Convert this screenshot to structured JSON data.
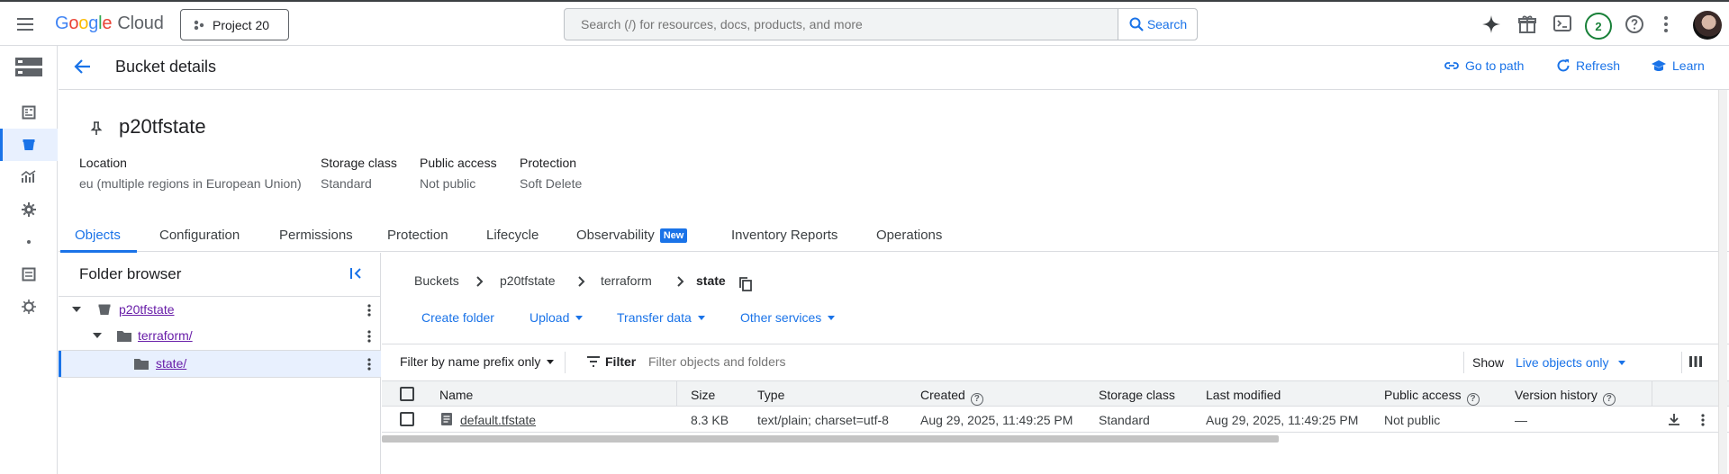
{
  "topbar": {
    "logo_letters": [
      "G",
      "o",
      "o",
      "g",
      "l",
      "e"
    ],
    "logo_suffix": "Cloud",
    "project": "Project 20",
    "search_placeholder": "Search (/) for resources, docs, products, and more",
    "search_button": "Search",
    "notification_count": "2"
  },
  "header": {
    "title": "Bucket details",
    "go_to_path": "Go to path",
    "refresh": "Refresh",
    "learn": "Learn"
  },
  "bucket": {
    "name": "p20tfstate",
    "meta": [
      {
        "label": "Location",
        "value": "eu (multiple regions in European Union)"
      },
      {
        "label": "Storage class",
        "value": "Standard"
      },
      {
        "label": "Public access",
        "value": "Not public"
      },
      {
        "label": "Protection",
        "value": "Soft Delete"
      }
    ]
  },
  "tabs": [
    {
      "label": "Objects",
      "active": true
    },
    {
      "label": "Configuration"
    },
    {
      "label": "Permissions"
    },
    {
      "label": "Protection"
    },
    {
      "label": "Lifecycle"
    },
    {
      "label": "Observability",
      "badge": "New"
    },
    {
      "label": "Inventory Reports"
    },
    {
      "label": "Operations"
    }
  ],
  "folder_browser": {
    "title": "Folder browser",
    "items": [
      {
        "label": "p20tfstate"
      },
      {
        "label": "terraform/"
      },
      {
        "label": "state/"
      }
    ]
  },
  "breadcrumb": [
    "Buckets",
    "p20tfstate",
    "terraform",
    "state"
  ],
  "actions": {
    "create_folder": "Create folder",
    "upload": "Upload",
    "transfer": "Transfer data",
    "other": "Other services"
  },
  "filter": {
    "mode": "Filter by name prefix only",
    "label": "Filter",
    "placeholder": "Filter objects and folders",
    "show_label": "Show",
    "show_value": "Live objects only"
  },
  "table": {
    "headers": [
      "Name",
      "Size",
      "Type",
      "Created",
      "Storage class",
      "Last modified",
      "Public access",
      "Version history"
    ],
    "rows": [
      {
        "name": "default.tfstate",
        "size": "8.3 KB",
        "type": "text/plain; charset=utf-8",
        "created": "Aug 29, 2025, 11:49:25 PM",
        "storage_class": "Standard",
        "last_modified": "Aug 29, 2025, 11:49:25 PM",
        "public_access": "Not public",
        "version_history": "—"
      }
    ]
  },
  "colors": {
    "accent": "#1a73e8",
    "visited_link": "#681da8",
    "selected_bg": "#e8f0fe"
  }
}
